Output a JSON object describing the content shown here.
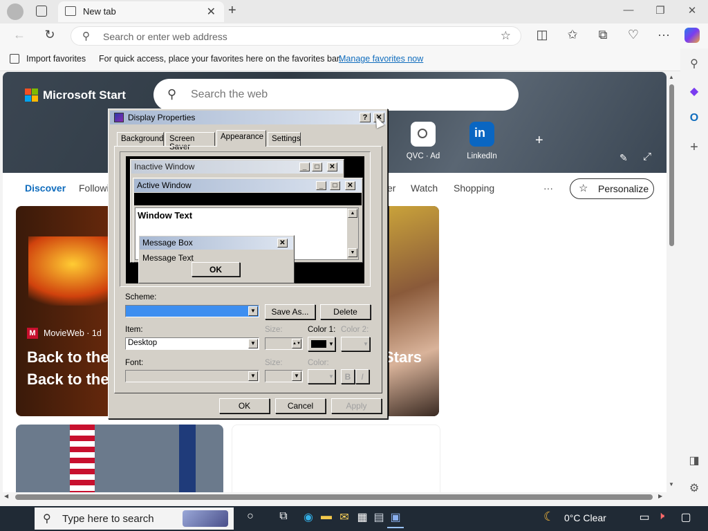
{
  "browser": {
    "tab_title": "New tab",
    "address_placeholder": "Search or enter web address",
    "favorites_bar": {
      "import_label": "Import favorites",
      "message": "For quick access, place your favorites here on the favorites bar.",
      "manage_link": "Manage favorites now"
    }
  },
  "msn": {
    "brand": "Microsoft Start",
    "search_placeholder": "Search the web",
    "quick_links": [
      {
        "label": "QVC · Ad"
      },
      {
        "label": "LinkedIn"
      }
    ],
    "feed_tabs": {
      "discover": "Discover",
      "following": "Followi",
      "partial": "er",
      "watch": "Watch",
      "shopping": "Shopping",
      "more": "···"
    },
    "personalize": "Personalize",
    "card": {
      "source": "MovieWeb · 1d",
      "title_line1": "Back to the",
      "title_line2": "Back to the",
      "right_fragment": "Stars"
    }
  },
  "dialog": {
    "title": "Display Properties",
    "tabs": [
      "Background",
      "Screen Saver",
      "Appearance",
      "Settings"
    ],
    "active_tab": "Appearance",
    "preview": {
      "inactive_window": "Inactive Window",
      "active_window": "Active Window",
      "window_text": "Window Text",
      "message_box": "Message Box",
      "message_text": "Message Text",
      "ok": "OK"
    },
    "scheme_label": "Scheme:",
    "save_as": "Save As...",
    "delete": "Delete",
    "item_label": "Item:",
    "item_value": "Desktop",
    "size_label": "Size:",
    "color1_label": "Color 1:",
    "color2_label": "Color 2:",
    "font_label": "Font:",
    "font_size_label": "Size:",
    "font_color_label": "Color:",
    "bold": "B",
    "italic": "I",
    "ok": "OK",
    "cancel": "Cancel",
    "apply": "Apply"
  },
  "taskbar": {
    "search_placeholder": "Type here to search",
    "weather": "0°C  Clear"
  },
  "colors": {
    "dialog_face": "#d4d0c8",
    "active_title": "#a7b8d2",
    "scheme_selection": "#3d8ef0",
    "link": "#0f6cbd"
  }
}
